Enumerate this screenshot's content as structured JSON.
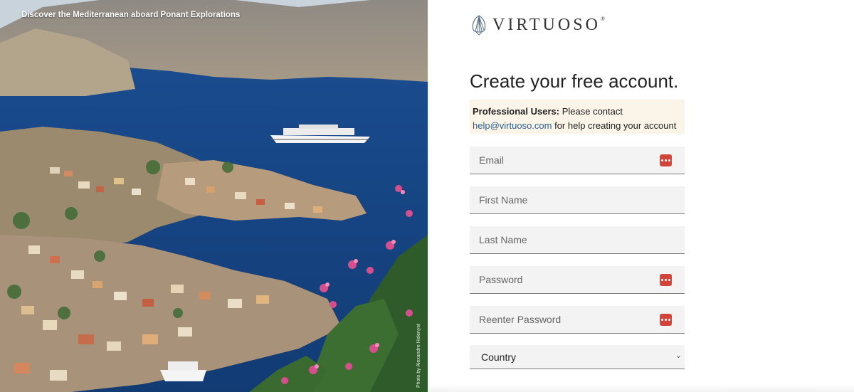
{
  "hero": {
    "caption": "Discover the Mediterranean aboard Ponant Explorations",
    "photo_credit": "Photo by Alexandre Helenyst"
  },
  "brand": {
    "logo_text": "VIRTUOSO",
    "registered": "®",
    "logo_icon": "shell-icon"
  },
  "form": {
    "title": "Create your free account.",
    "notice": {
      "bold": "Professional Users:",
      "text_before_link": " Please contact",
      "link": "help@virtuoso.com",
      "text_after_link": " for help creating your account"
    },
    "fields": {
      "email_placeholder": "Email",
      "first_name_placeholder": "First Name",
      "last_name_placeholder": "Last Name",
      "password_placeholder": "Password",
      "reenter_password_placeholder": "Reenter Password"
    },
    "country": {
      "selected": "Country",
      "chevron": "chevron-down-icon"
    },
    "password_manager_icon": "password-manager-icon"
  },
  "colors": {
    "notice_bg": "#fbf4e8",
    "link": "#2a5f8f",
    "pw_icon": "#d2433a",
    "field_bg": "#f3f3f3"
  }
}
